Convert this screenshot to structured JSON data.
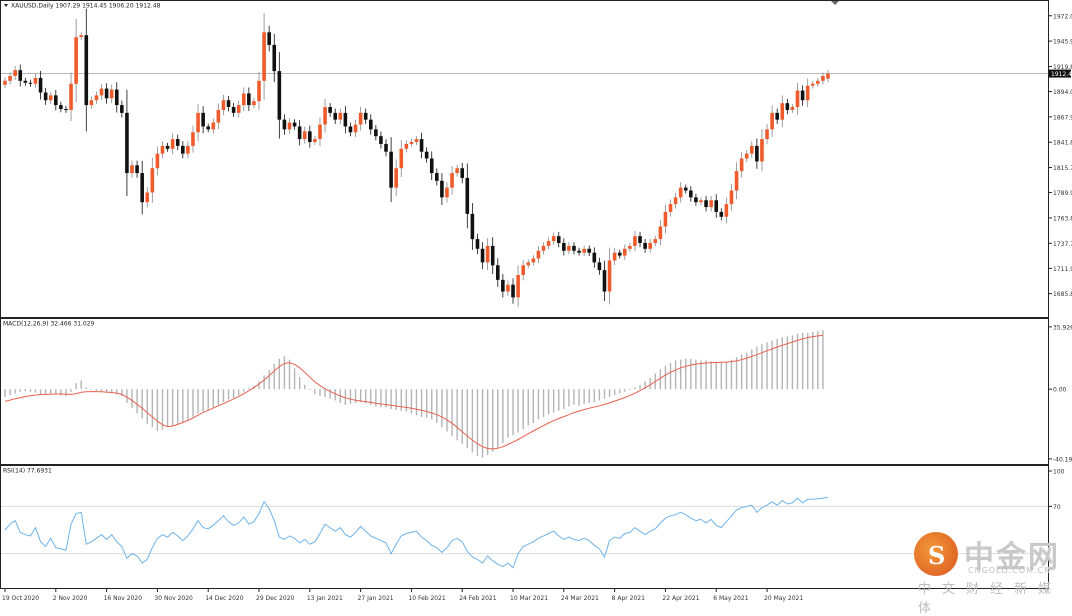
{
  "chart_data": {
    "type": "candlestick",
    "symbol_line": "XAUUSD,Daily  1907.29 1914.45 1906.20 1912.48",
    "current_price_label": "1912.48",
    "colors": {
      "bull": "#ef5b2a",
      "bear": "#111111",
      "macd_hist": "#b4b4b4",
      "macd_signal": "#e8614f",
      "rsi": "#6fb3ea",
      "grid": "#d8d8d8",
      "price_line": "#b8b8b8"
    },
    "price_axis": {
      "ylim": [
        1670,
        1980
      ],
      "ticks": [
        "1972.00",
        "1945.90",
        "1919.80",
        "1894.00",
        "1867.90",
        "1841.80",
        "1815.70",
        "1789.90",
        "1763.80",
        "1737.70",
        "1711.90",
        "1685.80"
      ],
      "current": 1912.48
    },
    "macd": {
      "label": "MACD(12,26,9) 32.466 31.029",
      "ylim": [
        -42,
        37
      ],
      "ticks": [
        "35.926",
        "0.00",
        "-40.194"
      ]
    },
    "rsi": {
      "label": "RSI(14) 77.6931",
      "ylim": [
        0,
        100
      ],
      "ticks": [
        "100",
        "70",
        "0"
      ],
      "levels": [
        70,
        30
      ]
    },
    "x_labels": [
      "19 Oct 2020",
      "2 Nov 2020",
      "16 Nov 2020",
      "30 Nov 2020",
      "14 Dec 2020",
      "29 Dec 2020",
      "13 Jan 2021",
      "27 Jan 2021",
      "10 Feb 2021",
      "24 Feb 2021",
      "10 Mar 2021",
      "24 Mar 2021",
      "8 Apr 2021",
      "22 Apr 2021",
      "6 May 2021",
      "20 May 2021"
    ],
    "x_label_bar_index": [
      0,
      10,
      20,
      30,
      40,
      50,
      60,
      70,
      80,
      90,
      100,
      110,
      120,
      130,
      140,
      150
    ],
    "closes": [
      1905,
      1910,
      1916,
      1905,
      1903,
      1902,
      1908,
      1893,
      1885,
      1890,
      1880,
      1876,
      1875,
      1902,
      1950,
      1952,
      1880,
      1885,
      1890,
      1897,
      1887,
      1896,
      1880,
      1872,
      1810,
      1818,
      1810,
      1780,
      1790,
      1815,
      1830,
      1838,
      1835,
      1845,
      1838,
      1830,
      1838,
      1852,
      1872,
      1858,
      1855,
      1862,
      1875,
      1885,
      1878,
      1872,
      1880,
      1892,
      1880,
      1884,
      1905,
      1955,
      1942,
      1915,
      1865,
      1855,
      1862,
      1858,
      1845,
      1853,
      1842,
      1845,
      1860,
      1878,
      1872,
      1865,
      1872,
      1858,
      1852,
      1860,
      1872,
      1865,
      1855,
      1848,
      1840,
      1832,
      1795,
      1815,
      1835,
      1840,
      1842,
      1845,
      1832,
      1825,
      1810,
      1802,
      1785,
      1795,
      1810,
      1815,
      1805,
      1768,
      1742,
      1732,
      1718,
      1735,
      1715,
      1700,
      1688,
      1695,
      1682,
      1705,
      1715,
      1718,
      1722,
      1730,
      1735,
      1740,
      1745,
      1738,
      1730,
      1735,
      1730,
      1728,
      1732,
      1728,
      1718,
      1710,
      1688,
      1720,
      1728,
      1725,
      1732,
      1735,
      1745,
      1738,
      1732,
      1738,
      1742,
      1755,
      1770,
      1778,
      1785,
      1795,
      1792,
      1785,
      1780,
      1782,
      1775,
      1782,
      1770,
      1765,
      1778,
      1792,
      1812,
      1825,
      1830,
      1838,
      1822,
      1845,
      1855,
      1872,
      1865,
      1882,
      1875,
      1878,
      1895,
      1885,
      1900,
      1902,
      1905,
      1910,
      1912.48
    ],
    "macd_hist": [
      -4.5,
      -3.5,
      -2.5,
      -1.5,
      -1.2,
      -1.5,
      -2,
      -3,
      -3.5,
      -2.5,
      -2.8,
      -3.6,
      -4,
      -1.5,
      3.5,
      5,
      1,
      -0.5,
      -1,
      -1.5,
      -2.2,
      -2,
      -3,
      -4,
      -8,
      -11,
      -14,
      -17,
      -20,
      -22,
      -24,
      -23.5,
      -22,
      -21,
      -20,
      -19.5,
      -18,
      -16,
      -14,
      -13,
      -12,
      -10.5,
      -9,
      -7.5,
      -6,
      -5,
      -3.5,
      -1.5,
      0.5,
      2,
      4.5,
      8,
      11,
      14.5,
      17.5,
      19,
      17,
      12,
      7,
      2.5,
      -0.5,
      -3,
      -4,
      -4.5,
      -5.5,
      -6.5,
      -8,
      -9,
      -8.5,
      -8,
      -7.5,
      -8,
      -9,
      -10,
      -10.5,
      -10.5,
      -11.5,
      -12,
      -12.5,
      -13,
      -14,
      -15,
      -16,
      -16.5,
      -17.5,
      -19.5,
      -22,
      -24.5,
      -27,
      -29.5,
      -31.5,
      -34,
      -36.5,
      -38.5,
      -39.5,
      -38,
      -36,
      -34,
      -31,
      -28,
      -26.5,
      -25,
      -23,
      -21,
      -19.5,
      -17.5,
      -16,
      -14.5,
      -13.5,
      -12.5,
      -11.5,
      -10,
      -9,
      -9.5,
      -8.5,
      -8,
      -7.5,
      -6.5,
      -5.5,
      -4.5,
      -3.5,
      -2.5,
      -1.5,
      -0.5,
      1,
      2.5,
      4.5,
      6.5,
      9,
      11.5,
      13.5,
      15,
      16.5,
      17,
      17.5,
      17.5,
      17,
      16.5,
      16.5,
      16,
      15.5,
      15.5,
      16,
      17,
      18.5,
      20,
      21,
      23,
      24.5,
      26,
      27,
      28,
      29,
      30,
      30.5,
      31,
      32,
      32.5,
      32.5,
      33,
      33.5,
      34
    ],
    "macd_signal": [
      -7,
      -6.3,
      -5.5,
      -4.9,
      -4.3,
      -3.8,
      -3.4,
      -3.1,
      -3,
      -2.9,
      -2.8,
      -2.8,
      -2.9,
      -3,
      -2.6,
      -1.8,
      -1.5,
      -1.4,
      -1.4,
      -1.5,
      -1.7,
      -1.9,
      -2.3,
      -3,
      -4.5,
      -6.5,
      -8.7,
      -11,
      -13.5,
      -16,
      -18.5,
      -20.5,
      -21.6,
      -21.3,
      -20.3,
      -19.2,
      -18,
      -16.6,
      -15,
      -13.5,
      -12.2,
      -10.9,
      -9.6,
      -8.3,
      -7,
      -5.6,
      -4.2,
      -2.6,
      -0.9,
      0.9,
      3,
      5.3,
      7.8,
      10.5,
      13,
      14.8,
      15.3,
      14.3,
      12.3,
      9.7,
      6.9,
      4.2,
      2,
      0.2,
      -1.3,
      -2.6,
      -3.9,
      -5,
      -5.8,
      -6.4,
      -6.8,
      -7.2,
      -7.6,
      -8.1,
      -8.5,
      -8.9,
      -9.3,
      -9.7,
      -10.1,
      -10.5,
      -11,
      -11.6,
      -12.2,
      -12.9,
      -13.7,
      -14.7,
      -16,
      -17.7,
      -19.7,
      -22,
      -24.5,
      -27,
      -29.4,
      -31.5,
      -33.2,
      -34.2,
      -34.5,
      -34.1,
      -33.2,
      -31.9,
      -30.5,
      -29,
      -27.4,
      -25.7,
      -24.1,
      -22.5,
      -21,
      -19.5,
      -18.1,
      -16.9,
      -15.8,
      -14.7,
      -13.5,
      -12.6,
      -11.8,
      -11,
      -10.3,
      -9.6,
      -8.8,
      -7.9,
      -6.9,
      -5.9,
      -4.8,
      -3.6,
      -2.3,
      -0.8,
      0.8,
      2.5,
      4.4,
      6.3,
      8.1,
      9.7,
      11.1,
      12.3,
      13.2,
      13.9,
      14.5,
      14.8,
      15.1,
      15.3,
      15.4,
      15.5,
      15.6,
      15.9,
      16.3,
      17,
      17.9,
      18.9,
      19.9,
      21,
      22.1,
      23.2,
      24.3,
      25.3,
      26.3,
      27.2,
      28.1,
      29,
      29.8,
      30.3,
      30.7,
      31.03
    ],
    "rsi_values": [
      50,
      55,
      58,
      48,
      46,
      45,
      52,
      40,
      36,
      43,
      35,
      34,
      33,
      55,
      64,
      65,
      38,
      40,
      43,
      46,
      42,
      46,
      40,
      36,
      26,
      30,
      28,
      22,
      25,
      35,
      43,
      46,
      44,
      48,
      45,
      41,
      45,
      51,
      58,
      52,
      51,
      54,
      58,
      62,
      57,
      54,
      56,
      61,
      55,
      57,
      64,
      74,
      68,
      58,
      44,
      42,
      45,
      43,
      39,
      42,
      38,
      40,
      47,
      55,
      52,
      49,
      52,
      46,
      44,
      48,
      53,
      49,
      45,
      43,
      41,
      39,
      30,
      38,
      45,
      47,
      48,
      49,
      44,
      41,
      37,
      35,
      31,
      35,
      41,
      43,
      40,
      32,
      27,
      25,
      22,
      28,
      24,
      21,
      19,
      22,
      18,
      30,
      36,
      38,
      40,
      43,
      45,
      47,
      49,
      45,
      42,
      44,
      42,
      41,
      43,
      41,
      37,
      34,
      27,
      41,
      44,
      43,
      47,
      48,
      52,
      49,
      46,
      49,
      51,
      56,
      60,
      62,
      63,
      65,
      63,
      60,
      58,
      59,
      56,
      59,
      54,
      52,
      57,
      62,
      67,
      69,
      70,
      71,
      65,
      69,
      71,
      74,
      71,
      75,
      72,
      73,
      77,
      73,
      76,
      76,
      76.5,
      77,
      77.69
    ]
  }
}
